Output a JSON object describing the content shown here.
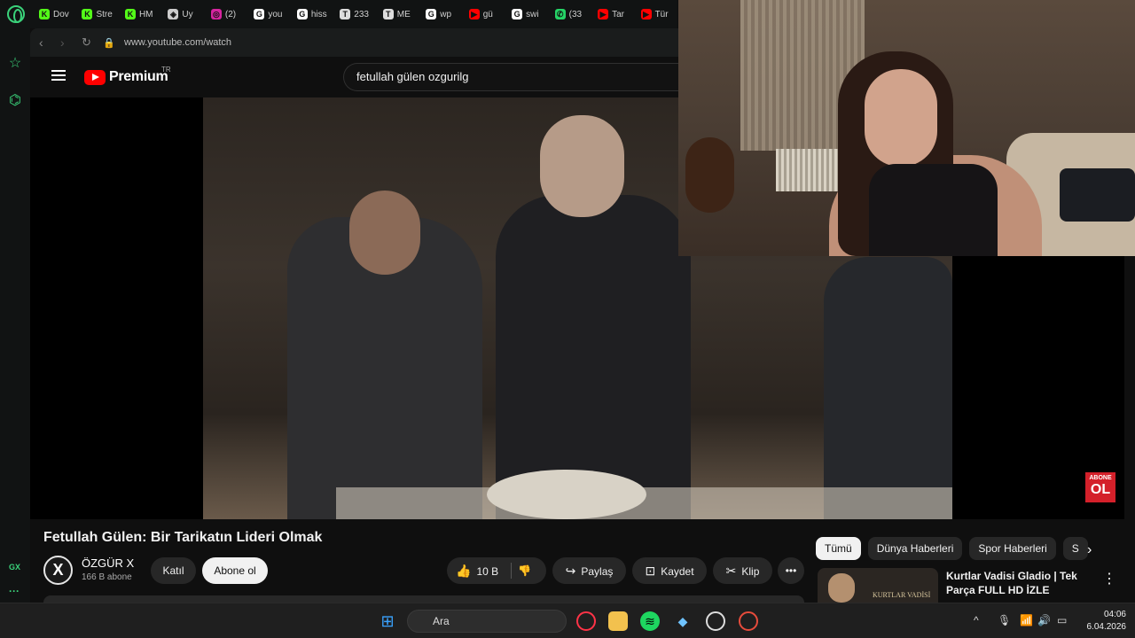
{
  "browser": {
    "bookmarks": [
      {
        "label": "Dov",
        "icon": "k-icon",
        "color": "#53fc18",
        "glyph": "K"
      },
      {
        "label": "Stre",
        "icon": "k-icon",
        "color": "#53fc18",
        "glyph": "K"
      },
      {
        "label": "HM",
        "icon": "k-icon",
        "color": "#53fc18",
        "glyph": "K"
      },
      {
        "label": "Uy",
        "icon": "diamond-icon",
        "color": "#cccccc",
        "glyph": "◈"
      },
      {
        "label": "(2)",
        "icon": "instagram-icon",
        "color": "#d6249f",
        "glyph": "◎"
      },
      {
        "label": "you",
        "icon": "google-icon",
        "color": "#ffffff",
        "glyph": "G"
      },
      {
        "label": "hiss",
        "icon": "google-icon",
        "color": "#ffffff",
        "glyph": "G"
      },
      {
        "label": "233",
        "icon": "tv-icon",
        "color": "#dddddd",
        "glyph": "T"
      },
      {
        "label": "ME",
        "icon": "tv-icon",
        "color": "#dddddd",
        "glyph": "T"
      },
      {
        "label": "wp",
        "icon": "google-icon",
        "color": "#ffffff",
        "glyph": "G"
      },
      {
        "label": "gü",
        "icon": "youtube-icon",
        "color": "#ff0000",
        "glyph": "▶"
      },
      {
        "label": "swi",
        "icon": "google-icon",
        "color": "#ffffff",
        "glyph": "G"
      },
      {
        "label": "(33",
        "icon": "whatsapp-icon",
        "color": "#25d366",
        "glyph": "✆"
      },
      {
        "label": "Tar",
        "icon": "youtube-icon",
        "color": "#ff0000",
        "glyph": "▶"
      },
      {
        "label": "Tür",
        "icon": "youtube-icon",
        "color": "#ff0000",
        "glyph": "▶"
      }
    ],
    "url": "www.youtube.com/watch",
    "sidebar_label": "GX",
    "sidebar_more": "···"
  },
  "youtube": {
    "brand": "Premium",
    "region": "TR",
    "search_query": "fetullah gülen  ozgurilg",
    "video_title": "Fetullah Gülen: Bir Tarikatın Lideri Olmak",
    "channel": {
      "name": "ÖZGÜR X",
      "subscribers": "166 B abone",
      "avatar_letter": "X"
    },
    "join_label": "Katıl",
    "subscribe_label": "Abone ol",
    "like_count": "10 B",
    "share_label": "Paylaş",
    "save_label": "Kaydet",
    "clip_label": "Klip",
    "overlay_badge": {
      "line1": "ABONE",
      "line2": "OL"
    },
    "chips": [
      "Tümü",
      "Dünya Haberleri",
      "Spor Haberleri",
      "S"
    ],
    "recommendation": {
      "title": "Kurtlar Vadisi Gladio | Tek Parça FULL HD İZLE",
      "thumb_text": "KURTLAR VADİSİ"
    }
  },
  "taskbar": {
    "search_placeholder": "Ara",
    "time": "04:06",
    "date": "6.04.2026"
  },
  "colors": {
    "accent_gx": "#3ad27a",
    "youtube_red": "#ff0000",
    "background": "#0f0f0f"
  }
}
